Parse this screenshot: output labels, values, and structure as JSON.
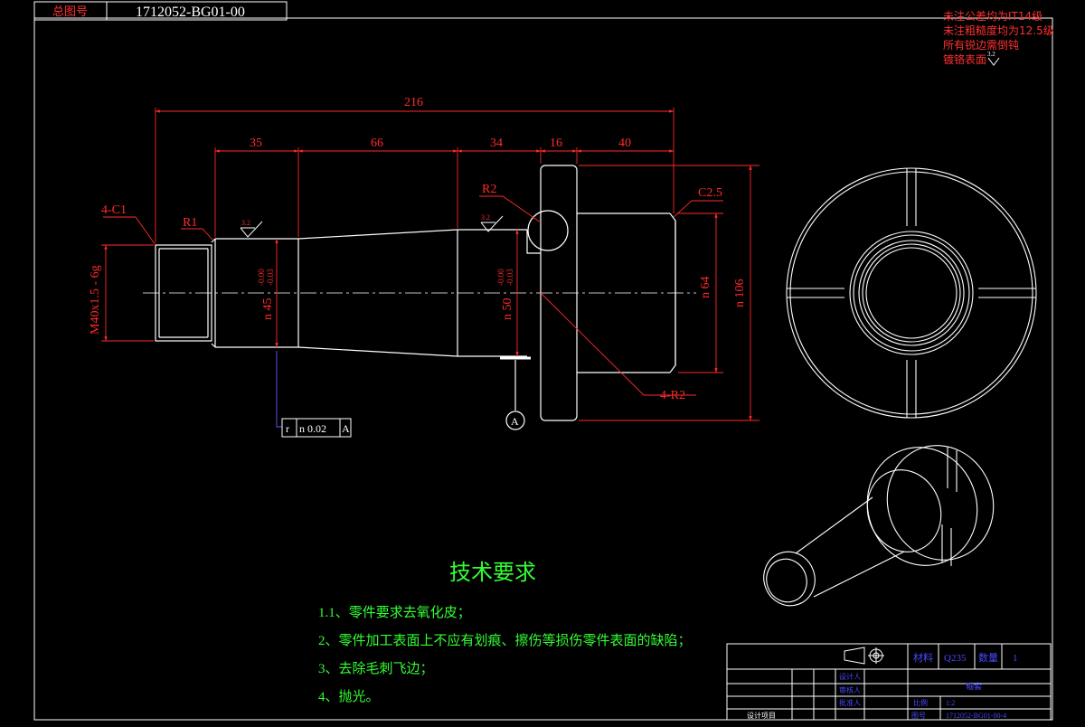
{
  "header": {
    "drawing_no_label": "总图号",
    "drawing_no": "1712052-BG01-00"
  },
  "general_notes": [
    "未注公差均为IT14级",
    "未注粗糙度均为12.5级",
    "所有锐边需倒钝",
    "镀铬表面"
  ],
  "notes_symbol_value": "3.2",
  "dimensions": {
    "overall_length": "216",
    "seg_1": "35",
    "seg_2": "66",
    "seg_3": "34",
    "seg_4": "16",
    "seg_5": "40",
    "chamfer_left": "4-C1",
    "chamfer_right": "C2.5",
    "radius_r1": "R1",
    "radius_r2": "R2",
    "radius_4r2": "4-R2",
    "thread": "M40x1.5 - 6g",
    "dia_45": "n 45",
    "dia_45_tol_upper": "-0.00",
    "dia_45_tol_lower": "-0.03",
    "dia_50": "n 50",
    "dia_50_tol_upper": "-0.00",
    "dia_50_tol_lower": "-0.03",
    "dia_64": "n 64",
    "dia_106": "n 106",
    "roughness_1": "3.2",
    "roughness_2": "3.2"
  },
  "geometric_tolerance": {
    "symbol": "r",
    "value": "n 0.02",
    "datum": "A"
  },
  "datum_label": "A",
  "tech_requirements": {
    "title": "技术要求",
    "items": [
      "1.1、零件要求去氧化皮；",
      "2、零件加工表面上不应有划痕、擦伤等损伤零件表面的缺陷；",
      "3、去除毛刺飞边；",
      "4、抛光。"
    ]
  },
  "title_block": {
    "material_label": "材料",
    "material": "Q235",
    "qty_label": "数量",
    "qty": "1",
    "part_name": "轴套",
    "row_labels": [
      "设计人",
      "审核人",
      "批准人"
    ],
    "bottom_left": "设计项目",
    "scale_label": "比例",
    "scale": "1:2",
    "drawing_no_label": "图号",
    "drawing_no": "1712052-BG01-00-4"
  },
  "colors": {
    "background": "#000000",
    "outline": "#ffffff",
    "dimension": "#ff2a2a",
    "leader": "#7a4dff",
    "text_green": "#33ff33",
    "notes_red": "#ff3030"
  }
}
